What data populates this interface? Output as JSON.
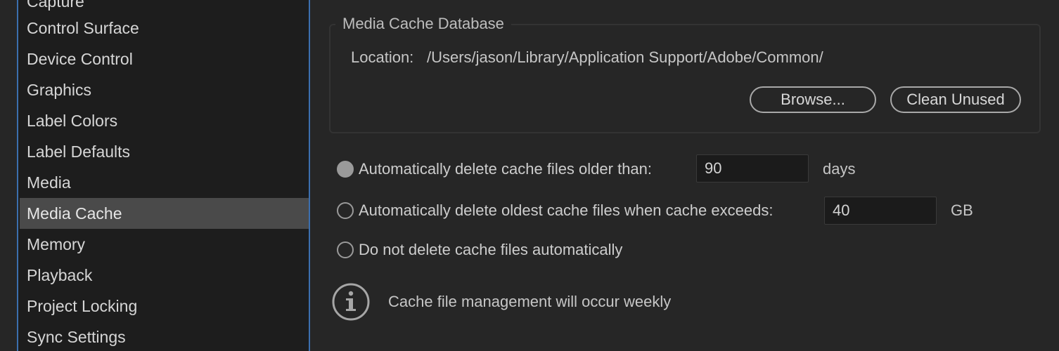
{
  "sidebar": {
    "items": [
      {
        "label": "Capture",
        "selected": false
      },
      {
        "label": "Control Surface",
        "selected": false
      },
      {
        "label": "Device Control",
        "selected": false
      },
      {
        "label": "Graphics",
        "selected": false
      },
      {
        "label": "Label Colors",
        "selected": false
      },
      {
        "label": "Label Defaults",
        "selected": false
      },
      {
        "label": "Media",
        "selected": false
      },
      {
        "label": "Media Cache",
        "selected": true
      },
      {
        "label": "Memory",
        "selected": false
      },
      {
        "label": "Playback",
        "selected": false
      },
      {
        "label": "Project Locking",
        "selected": false
      },
      {
        "label": "Sync Settings",
        "selected": false
      }
    ]
  },
  "media_cache_database": {
    "title": "Media Cache Database",
    "location_label": "Location:",
    "location_path": "/Users/jason/Library/Application Support/Adobe/Common/",
    "browse_label": "Browse...",
    "clean_unused_label": "Clean Unused"
  },
  "options": {
    "older_than": {
      "label": "Automatically delete cache files older than:",
      "value": "90",
      "unit": "days",
      "checked": true
    },
    "exceeds": {
      "label": "Automatically delete oldest cache files when cache exceeds:",
      "value": "40",
      "unit": "GB",
      "checked": false
    },
    "do_not_delete": {
      "label": "Do not delete cache files automatically",
      "checked": false
    }
  },
  "info": {
    "icon": "info-icon",
    "text": "Cache file management will occur weekly"
  },
  "colors": {
    "accent": "#3b6fae",
    "selected_row": "#4a4a4a",
    "background": "#262626",
    "sidebar_background": "#1d1d1d"
  }
}
